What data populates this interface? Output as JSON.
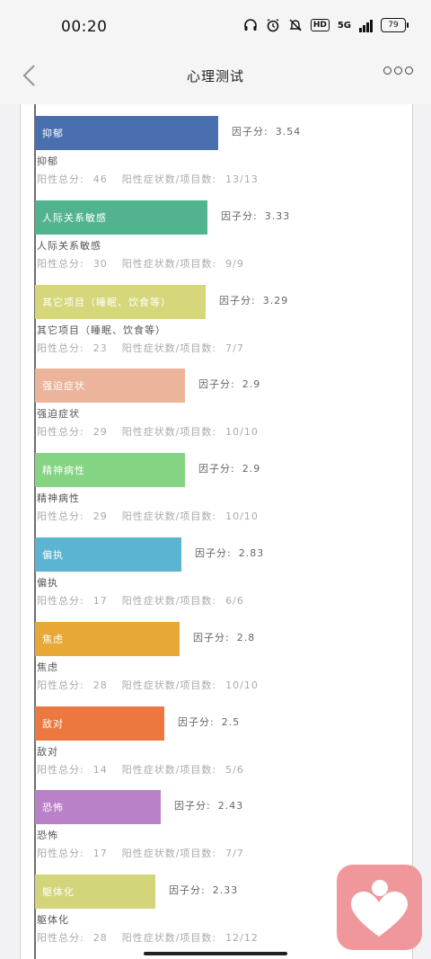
{
  "status": {
    "time": "00:20",
    "battery": "79",
    "network": "5G"
  },
  "nav": {
    "title": "心理测试"
  },
  "labels": {
    "score": "因子分:",
    "total": "阳性总分:",
    "count": "阳性症状数/项目数:"
  },
  "chart_data": {
    "type": "bar",
    "orientation": "horizontal",
    "categories": [
      "抑郁",
      "人际关系敏感",
      "其它项目（睡眠、饮食等）",
      "强迫症状",
      "精神病性",
      "偏执",
      "焦虑",
      "敌对",
      "恐怖",
      "躯体化"
    ],
    "values": [
      3.54,
      3.33,
      3.29,
      2.9,
      2.9,
      2.83,
      2.8,
      2.5,
      2.43,
      2.33
    ],
    "colors": [
      "#4a6fae",
      "#52b48f",
      "#d5d77a",
      "#ebb49b",
      "#84d483",
      "#5ab4d2",
      "#e8a836",
      "#ec7840",
      "#b981c8",
      "#d3d57a"
    ]
  },
  "items": [
    {
      "name": "抑郁",
      "score": "3.54",
      "total": "46",
      "count": "13/13"
    },
    {
      "name": "人际关系敏感",
      "score": "3.33",
      "total": "30",
      "count": "9/9"
    },
    {
      "name": "其它项目（睡眠、饮食等）",
      "score": "3.29",
      "total": "23",
      "count": "7/7"
    },
    {
      "name": "强迫症状",
      "score": "2.9",
      "total": "29",
      "count": "10/10"
    },
    {
      "name": "精神病性",
      "score": "2.9",
      "total": "29",
      "count": "10/10"
    },
    {
      "name": "偏执",
      "score": "2.83",
      "total": "17",
      "count": "6/6"
    },
    {
      "name": "焦虑",
      "score": "2.8",
      "total": "28",
      "count": "10/10"
    },
    {
      "name": "敌对",
      "score": "2.5",
      "total": "14",
      "count": "5/6"
    },
    {
      "name": "恐怖",
      "score": "2.43",
      "total": "17",
      "count": "7/7"
    },
    {
      "name": "躯体化",
      "score": "2.33",
      "total": "28",
      "count": "12/12"
    }
  ]
}
